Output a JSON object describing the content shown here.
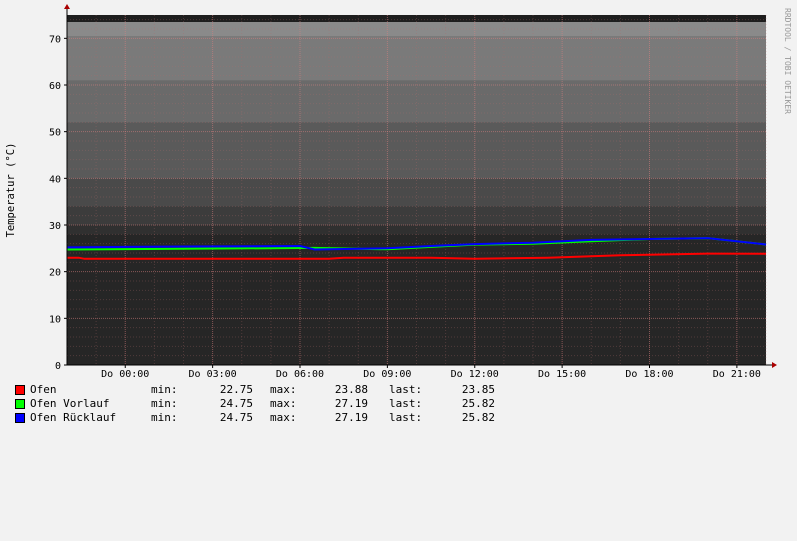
{
  "chart_data": {
    "type": "line",
    "ylabel": "Temperatur (°C)",
    "watermark": "RRDTOOL / TOBI OETIKER",
    "ylim": [
      0,
      75
    ],
    "y_ticks": [
      0,
      10,
      20,
      30,
      40,
      50,
      60,
      70
    ],
    "x_ticks": [
      "Do 00:00",
      "Do 03:00",
      "Do 06:00",
      "Do 09:00",
      "Do 12:00",
      "Do 15:00",
      "Do 18:00",
      "Do 21:00"
    ],
    "x_tick_hours": [
      0,
      3,
      6,
      9,
      12,
      15,
      18,
      21
    ],
    "xlim_hours": [
      -2,
      22
    ],
    "grid": true,
    "background_band_tops": [
      73.5,
      70.5,
      61,
      52,
      40,
      34,
      30,
      28
    ],
    "series": [
      {
        "name": "Ofen",
        "color": "#ff0000",
        "x": [
          -2,
          -1.6,
          -1.4,
          7,
          7.5,
          10.5,
          12,
          14.5,
          17,
          20,
          22
        ],
        "values": [
          23.0,
          23.0,
          22.75,
          22.75,
          23.0,
          23.0,
          22.75,
          23.0,
          23.5,
          23.88,
          23.85
        ]
      },
      {
        "name": "Ofen Vorlauf",
        "color": "#00ff00",
        "x": [
          -2,
          2,
          6.5,
          9,
          10.5,
          12,
          14,
          16,
          18,
          20,
          22
        ],
        "values": [
          24.75,
          24.9,
          25.1,
          24.8,
          25.3,
          25.8,
          26.0,
          26.5,
          27.0,
          27.19,
          25.82
        ]
      },
      {
        "name": "Ofen Rücklauf",
        "color": "#0000ff",
        "x": [
          -2,
          2,
          6,
          6.5,
          9,
          10.5,
          12,
          14,
          16,
          18,
          20,
          22
        ],
        "values": [
          25.2,
          25.4,
          25.5,
          24.75,
          25.0,
          25.5,
          25.9,
          26.2,
          26.8,
          27.0,
          27.19,
          25.82
        ]
      }
    ]
  },
  "legend": [
    {
      "color": "#ff0000",
      "label": "Ofen",
      "min_label": "min:",
      "min": "22.75",
      "max_label": "max:",
      "max": "23.88",
      "last_label": "last:",
      "last": "23.85"
    },
    {
      "color": "#00ff00",
      "label": "Ofen Vorlauf",
      "min_label": "min:",
      "min": "24.75",
      "max_label": "max:",
      "max": "27.19",
      "last_label": "last:",
      "last": "25.82"
    },
    {
      "color": "#0000ff",
      "label": "Ofen Rücklauf",
      "min_label": "min:",
      "min": "24.75",
      "max_label": "max:",
      "max": "27.19",
      "last_label": "last:",
      "last": "25.82"
    }
  ]
}
